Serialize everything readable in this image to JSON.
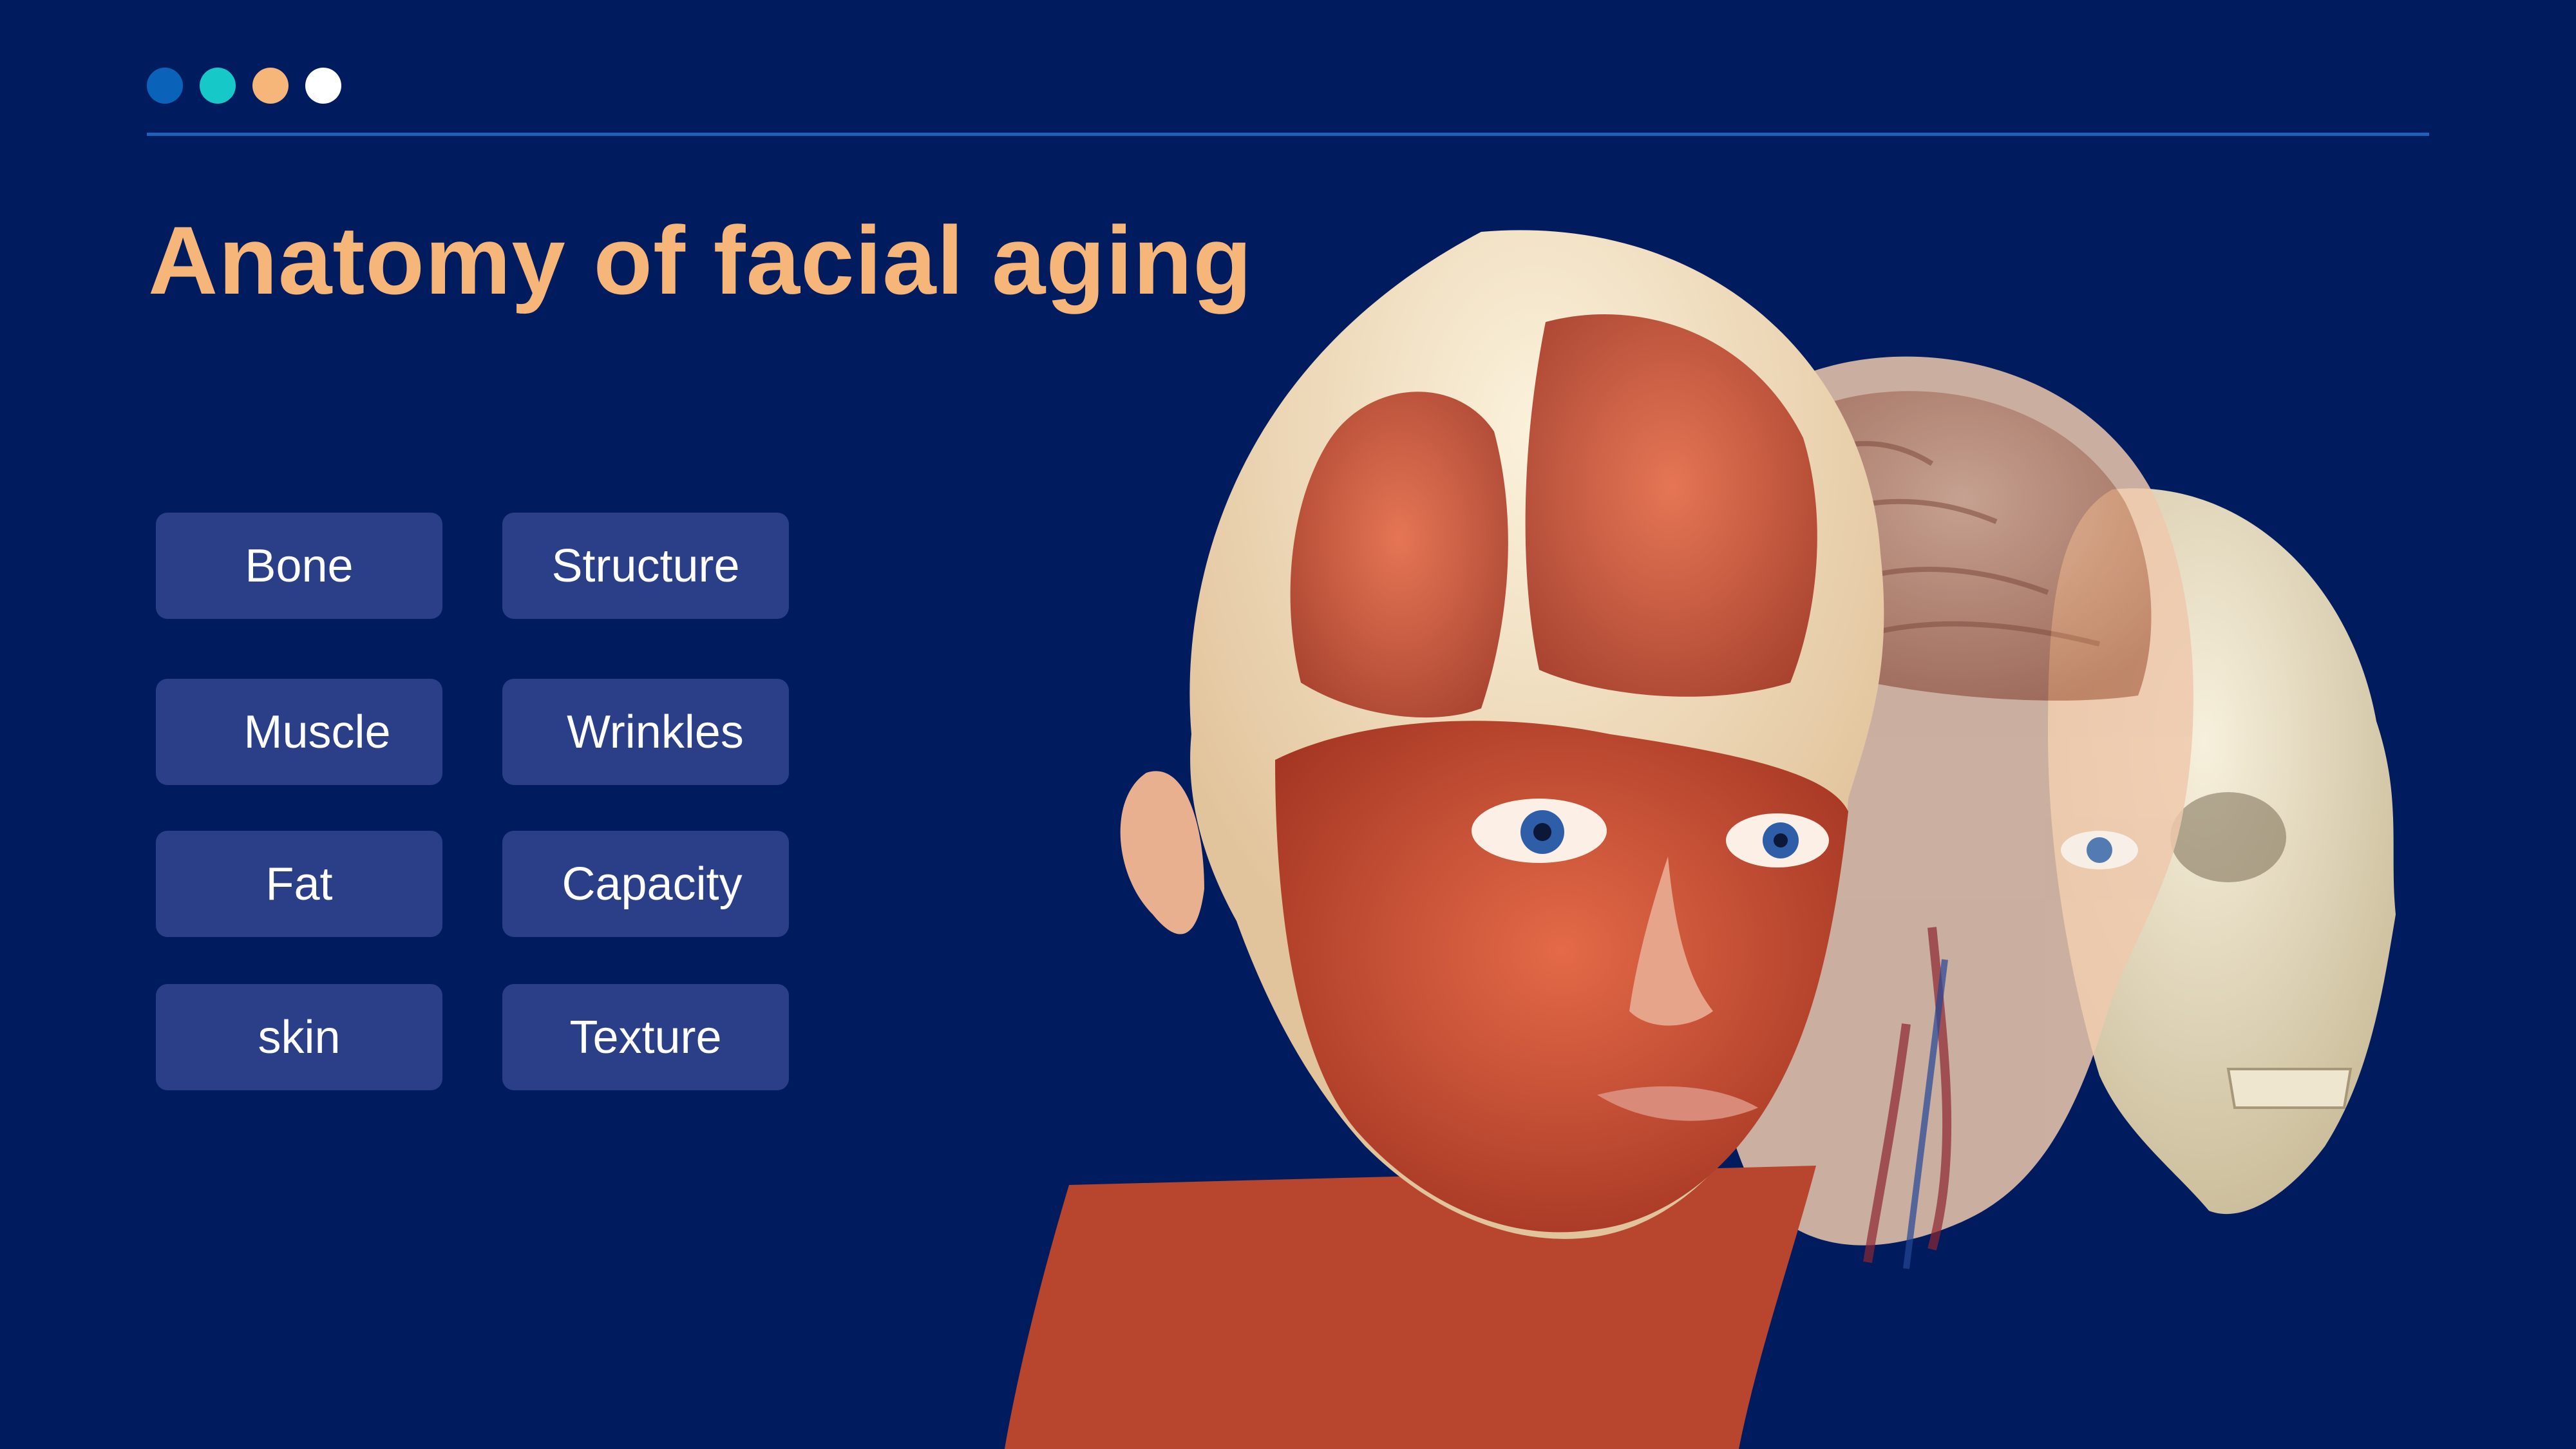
{
  "slide": {
    "title": "Anatomy of facial aging",
    "dots": [
      {
        "name": "dot-dark-blue",
        "color": "#0a63b8"
      },
      {
        "name": "dot-teal",
        "color": "#16c8c8"
      },
      {
        "name": "dot-peach",
        "color": "#f6b67a"
      },
      {
        "name": "dot-white",
        "color": "#ffffff"
      }
    ],
    "colors": {
      "background": "#001b5e",
      "title": "#f6b67a",
      "button": "#2b3f88",
      "rule": "#1c62b8"
    }
  },
  "buttons": [
    {
      "name": "bone-button",
      "label": "Bone"
    },
    {
      "name": "structure-button",
      "label": "Structure"
    },
    {
      "name": "muscle-button",
      "label": "Muscle"
    },
    {
      "name": "wrinkles-button",
      "label": "Wrinkles"
    },
    {
      "name": "fat-button",
      "label": "Fat"
    },
    {
      "name": "capacity-button",
      "label": "Capacity"
    },
    {
      "name": "skin-button",
      "label": "skin"
    },
    {
      "name": "texture-button",
      "label": "Texture"
    }
  ],
  "illustration": {
    "icon": "anatomical-head-layers-illustration"
  }
}
